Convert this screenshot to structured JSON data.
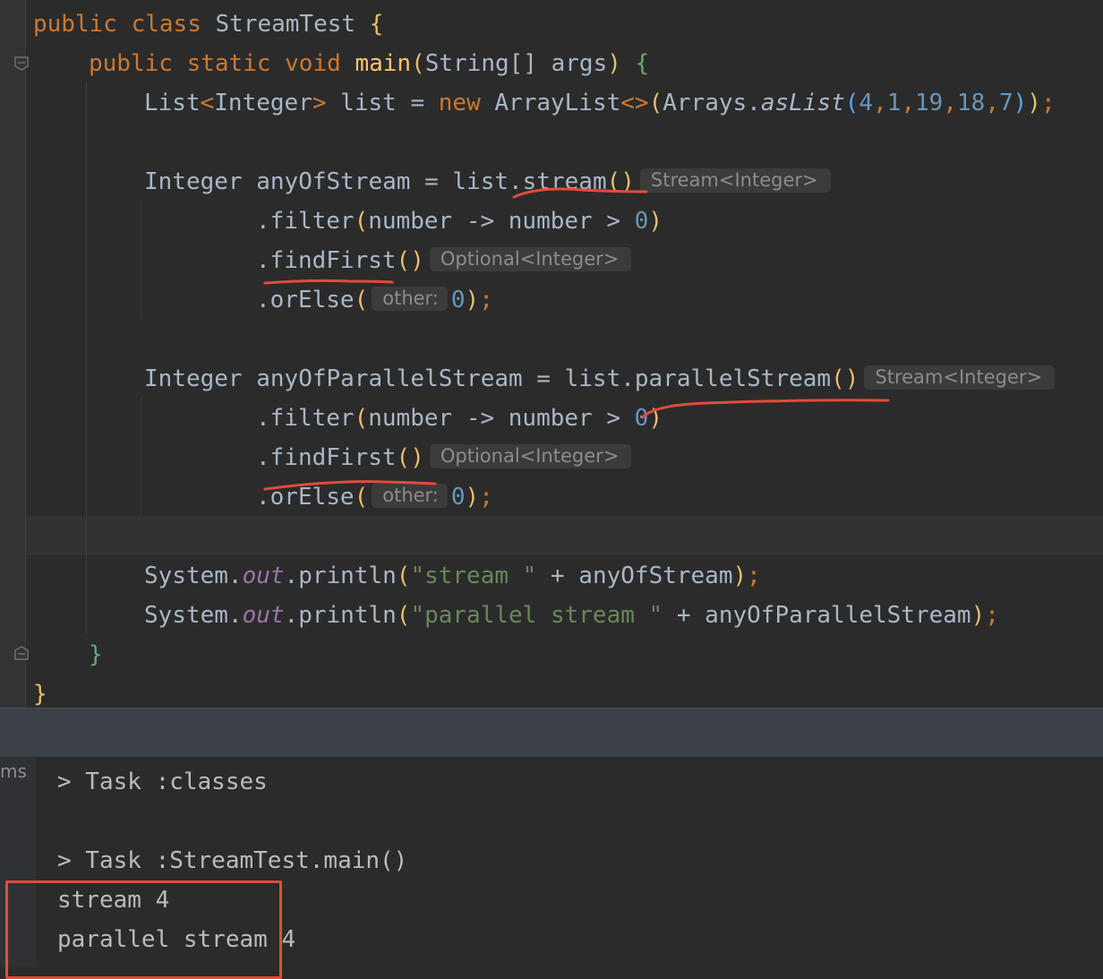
{
  "editor": {
    "class_decl": {
      "kw1": "public",
      "kw2": "class",
      "name": "StreamTest",
      "brace": "{"
    },
    "main_decl": {
      "kw1": "public",
      "kw2": "static",
      "kw3": "void",
      "name": "main",
      "param_type": "String[]",
      "param_name": "args",
      "brace": "{"
    },
    "list_decl": {
      "type": "List",
      "generic": "Integer",
      "var": "list",
      "eq": "=",
      "kw_new": "new",
      "ctor": "ArrayList",
      "diamond": "<>",
      "util": "Arrays",
      "method": "asList",
      "values": [
        "4",
        "1",
        "19",
        "18",
        "7"
      ]
    },
    "block1": {
      "type": "Integer",
      "var": "anyOfStream",
      "target": "list",
      "call": "stream",
      "call_hint": "Stream<Integer>",
      "filter": "filter",
      "lambda_param": "number",
      "arrow": "->",
      "gt": ">",
      "zero": "0",
      "find": "findFirst",
      "find_hint": "Optional<Integer>",
      "orelse": "orElse",
      "orelse_hint": "other:",
      "orelse_val": "0"
    },
    "block2": {
      "type": "Integer",
      "var": "anyOfParallelStream",
      "target": "list",
      "call": "parallelStream",
      "call_hint": "Stream<Integer>",
      "filter": "filter",
      "lambda_param": "number",
      "arrow": "->",
      "gt": ">",
      "zero": "0",
      "find": "findFirst",
      "find_hint": "Optional<Integer>",
      "orelse": "orElse",
      "orelse_hint": "other:",
      "orelse_val": "0"
    },
    "print1": {
      "cls": "System",
      "field": "out",
      "method": "println",
      "literal": "\"stream \"",
      "plus": "+",
      "var": "anyOfStream"
    },
    "print2": {
      "cls": "System",
      "field": "out",
      "method": "println",
      "literal": "\"parallel stream \"",
      "plus": "+",
      "var": "anyOfParallelStream"
    },
    "close_main": "}",
    "close_class": "}"
  },
  "console": {
    "side_label": "ms",
    "lines": [
      "> Task :classes",
      "> Task :StreamTest.main()",
      "stream 4",
      "parallel stream 4"
    ]
  },
  "colors": {
    "background": "#2b2b2b",
    "keyword": "#cc7832",
    "function": "#ffc66d",
    "number": "#6897bb",
    "string": "#6a8759",
    "annotation_red": "#e24b3b"
  }
}
